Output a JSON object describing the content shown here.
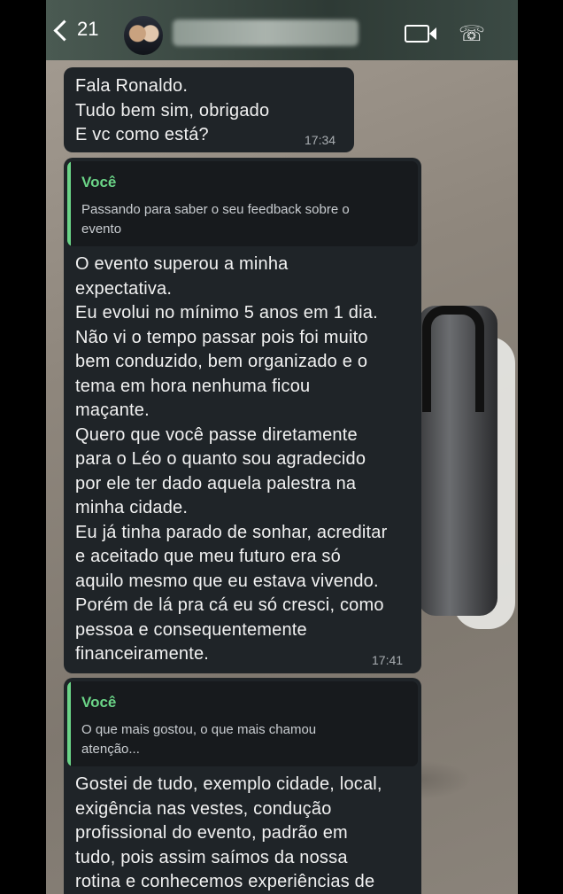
{
  "header": {
    "back_count": "21",
    "icons": [
      "chevron-left-icon",
      "avatar",
      "video-call-icon",
      "phone-call-icon"
    ]
  },
  "messages": [
    {
      "text": "Fala Ronaldo.\nTudo bem sim, obrigado\nE vc como está?",
      "time": "17:34"
    },
    {
      "quote_author": "Você",
      "quote_text": "Passando para saber o seu feedback sobre o\nevento",
      "text": "O evento superou a minha\nexpectativa.\nEu evolui no mínimo 5 anos em 1 dia.\nNão vi o tempo passar pois foi muito\nbem conduzido, bem organizado e o\ntema em hora nenhuma ficou\nmaçante.\nQuero que você passe diretamente\npara o Léo o quanto sou agradecido\npor ele ter dado aquela palestra na\nminha cidade.\nEu já tinha parado de sonhar, acreditar\ne aceitado que meu futuro era só\naquilo mesmo que eu estava vivendo.\nPorém de lá pra cá eu só cresci, como\npessoa e consequentemente\nfinanceiramente.",
      "time": "17:41"
    },
    {
      "quote_author": "Você",
      "quote_text": "O que mais gostou, o que mais chamou\natenção...",
      "text": "Gostei de tudo, exemplo cidade, local,\nexigência nas vestes, condução\nprofissional do evento, padrão em\ntudo, pois assim saímos da nossa\nrotina e conhecemos experiências de"
    }
  ]
}
